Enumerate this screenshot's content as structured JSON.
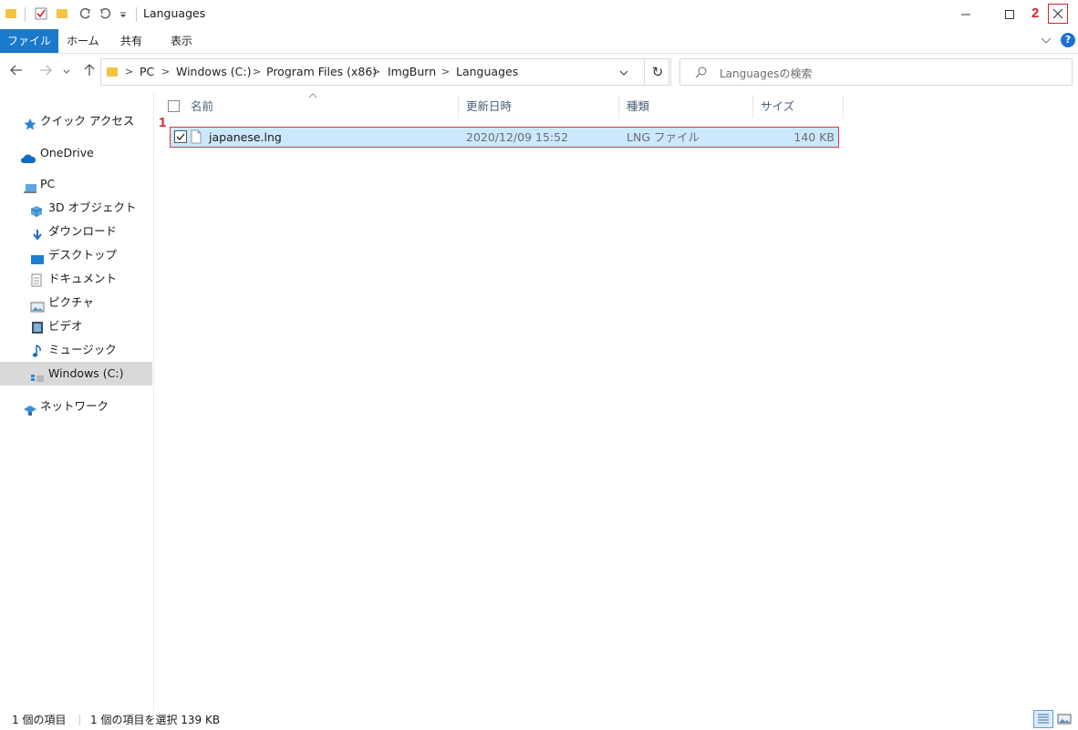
{
  "window": {
    "title": "Languages"
  },
  "ribbon": {
    "tabs": [
      "ファイル",
      "ホーム",
      "共有",
      "表示"
    ]
  },
  "address": {
    "path": [
      "PC",
      "Windows (C:)",
      "Program Files (x86)",
      "ImgBurn",
      "Languages"
    ],
    "search_placeholder": "Languagesの検索"
  },
  "nav": {
    "items": [
      {
        "label": "クイック アクセス",
        "icon": "star-icon"
      },
      {
        "label": "OneDrive",
        "icon": "cloud-icon"
      },
      {
        "label": "PC",
        "icon": "pc-icon"
      },
      {
        "label": "3D オブジェクト",
        "icon": "cube-icon"
      },
      {
        "label": "ダウンロード",
        "icon": "download-icon"
      },
      {
        "label": "デスクトップ",
        "icon": "desktop-icon"
      },
      {
        "label": "ドキュメント",
        "icon": "document-icon"
      },
      {
        "label": "ピクチャ",
        "icon": "picture-icon"
      },
      {
        "label": "ビデオ",
        "icon": "video-icon"
      },
      {
        "label": "ミュージック",
        "icon": "music-icon"
      },
      {
        "label": "Windows (C:)",
        "icon": "drive-icon"
      },
      {
        "label": "ネットワーク",
        "icon": "network-icon"
      }
    ]
  },
  "columns": {
    "name": "名前",
    "modified": "更新日時",
    "type": "種類",
    "size": "サイズ"
  },
  "files": [
    {
      "name": "japanese.lng",
      "modified": "2020/12/09 15:52",
      "type": "LNG ファイル",
      "size": "140 KB"
    }
  ],
  "markers": {
    "one": "1",
    "two": "2"
  },
  "status": {
    "count": "1 個の項目",
    "selected": "1 個の項目を選択  139 KB"
  },
  "colors": {
    "accent": "#1979ca",
    "selection": "#cce8ff",
    "marker": "#d9212b"
  }
}
